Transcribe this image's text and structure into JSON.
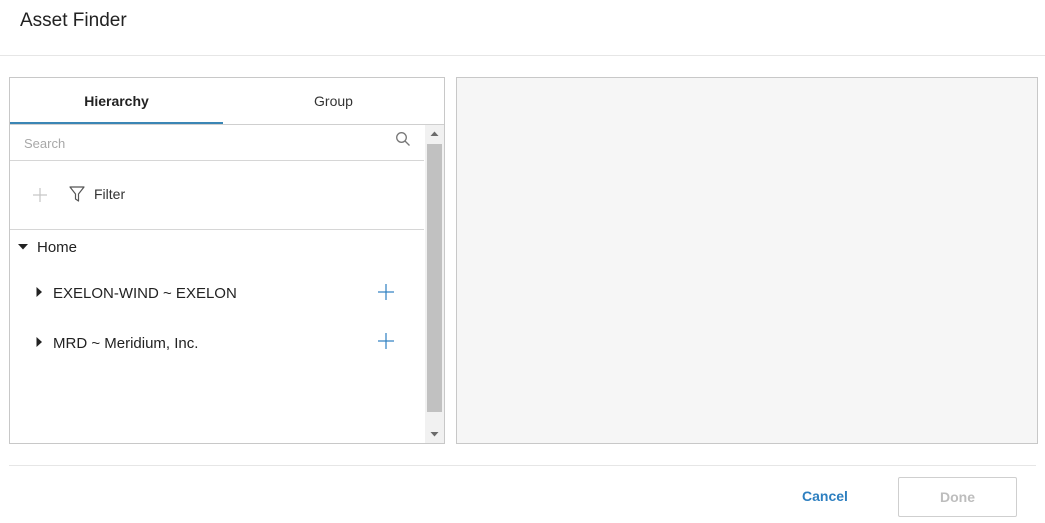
{
  "dialog": {
    "title": "Asset Finder"
  },
  "tabs": [
    {
      "label": "Hierarchy",
      "active": true
    },
    {
      "label": "Group",
      "active": false
    }
  ],
  "search": {
    "placeholder": "Search",
    "value": ""
  },
  "toolbar": {
    "add_icon": "plus-icon",
    "filter_label": "Filter",
    "filter_icon": "funnel-icon"
  },
  "tree": {
    "root": {
      "label": "Home",
      "expanded": true
    },
    "children": [
      {
        "label": "EXELON-WIND ~ EXELON",
        "expanded": false
      },
      {
        "label": "MRD ~ Meridium, Inc.",
        "expanded": false
      }
    ]
  },
  "footer": {
    "cancel_label": "Cancel",
    "done_label": "Done"
  },
  "colors": {
    "accent": "#2d7fc0",
    "tab_underline": "#3a86b5",
    "disabled_text": "#bdbdbd",
    "preview_bg": "#f6f6f6"
  }
}
